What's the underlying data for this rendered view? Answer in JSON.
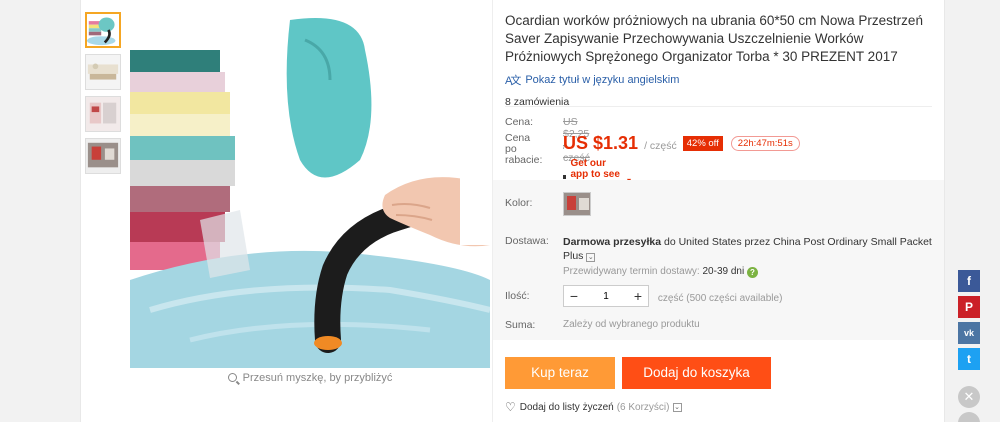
{
  "product": {
    "title": "Ocardian worków próżniowych na ubrania 60*50 cm Nowa Przestrzeń Saver Zapisywanie Przechowywania Uszczelnienie Worków Próżniowych Sprężonego Organizator Torba * 30 PREZENT 2017",
    "translate_link": "Pokaż tytuł w języku angielskim",
    "orders": "8 zamówienia"
  },
  "gallery": {
    "zoom_hint": "Przesuń myszkę, by przybliżyć",
    "thumbnails": [
      "thumb-1",
      "thumb-2",
      "thumb-3",
      "thumb-4"
    ]
  },
  "pricing": {
    "price_label": "Cena:",
    "old_price": "US $2,25 / część",
    "discount_label_1": "Cena po",
    "discount_label_2": "rabacie:",
    "new_price": "US $1.31",
    "per_unit": "/ część",
    "off_badge": "42% off",
    "timer": "22h:47m:51s",
    "app_promo": "Get our app to see exclusive prices",
    "app_promo_arrow": "▾"
  },
  "options": {
    "color_label": "Kolor:",
    "shipping_label": "Dostawa:",
    "shipping_text_bold": "Darmowa przesyłka",
    "shipping_text_rest": " do United States przez China Post Ordinary Small Packet Plus",
    "shipping_dropdown": "⌄",
    "estimate_label": "Przewidywany termin dostawy:",
    "estimate_days": "20-39",
    "estimate_unit": "dni",
    "help": "?",
    "qty_label": "Ilość:",
    "qty_minus": "−",
    "qty_value": "1",
    "qty_plus": "+",
    "qty_note": "część (500 części available)",
    "total_label": "Suma:",
    "total_value": "Zależy od wybranego produktu"
  },
  "actions": {
    "buy_now": "Kup teraz",
    "add_to_cart": "Dodaj do koszyka",
    "wishlist": "Dodaj do listy życzeń",
    "wishlist_count": "(6 Korzyści)",
    "wishlist_dropdown": "⌄"
  },
  "social": {
    "facebook": "f",
    "pinterest": "P",
    "vk": "vk",
    "twitter": "t",
    "close": "✕"
  },
  "colors": {
    "price_red": "#e62e04",
    "buy_orange": "#ff9a36",
    "cart_orange": "#ff4e15",
    "link_blue": "#2a5fa8"
  }
}
